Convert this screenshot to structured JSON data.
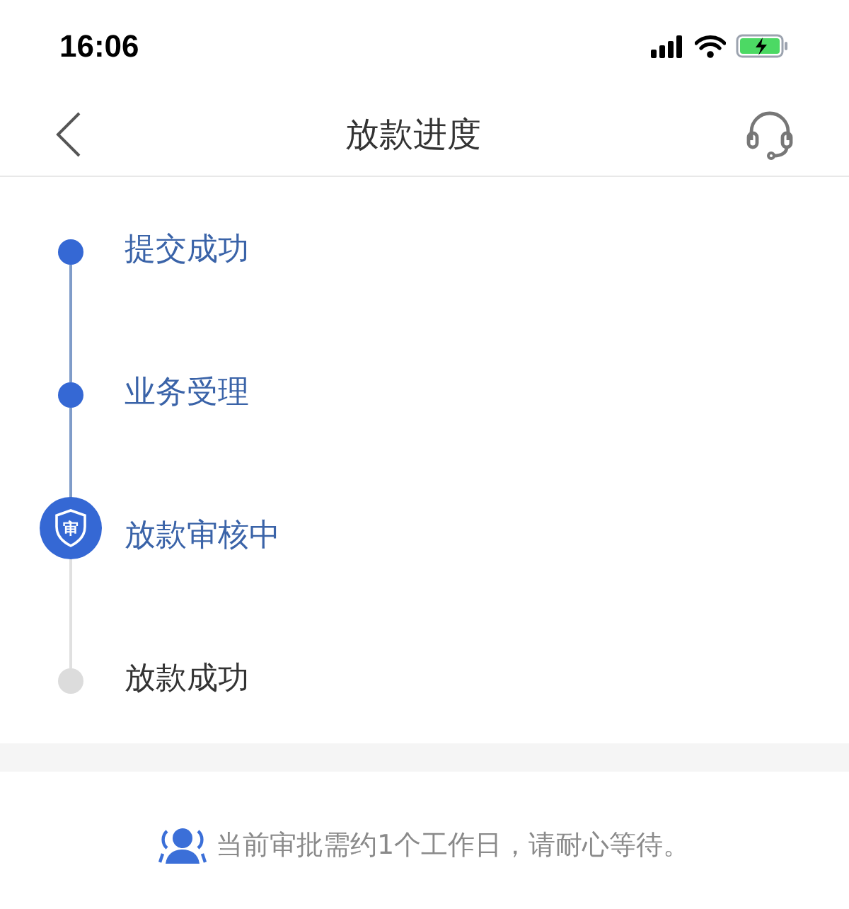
{
  "status_bar": {
    "time": "16:06"
  },
  "header": {
    "title": "放款进度"
  },
  "steps": [
    {
      "label": "提交成功",
      "done": true,
      "current": false
    },
    {
      "label": "业务受理",
      "done": true,
      "current": false
    },
    {
      "label": "放款审核中",
      "done": true,
      "current": true,
      "badge_text": "审"
    },
    {
      "label": "放款成功",
      "done": false,
      "current": false
    }
  ],
  "notice": {
    "text": "当前审批需约1个工作日，请耐心等待。"
  }
}
